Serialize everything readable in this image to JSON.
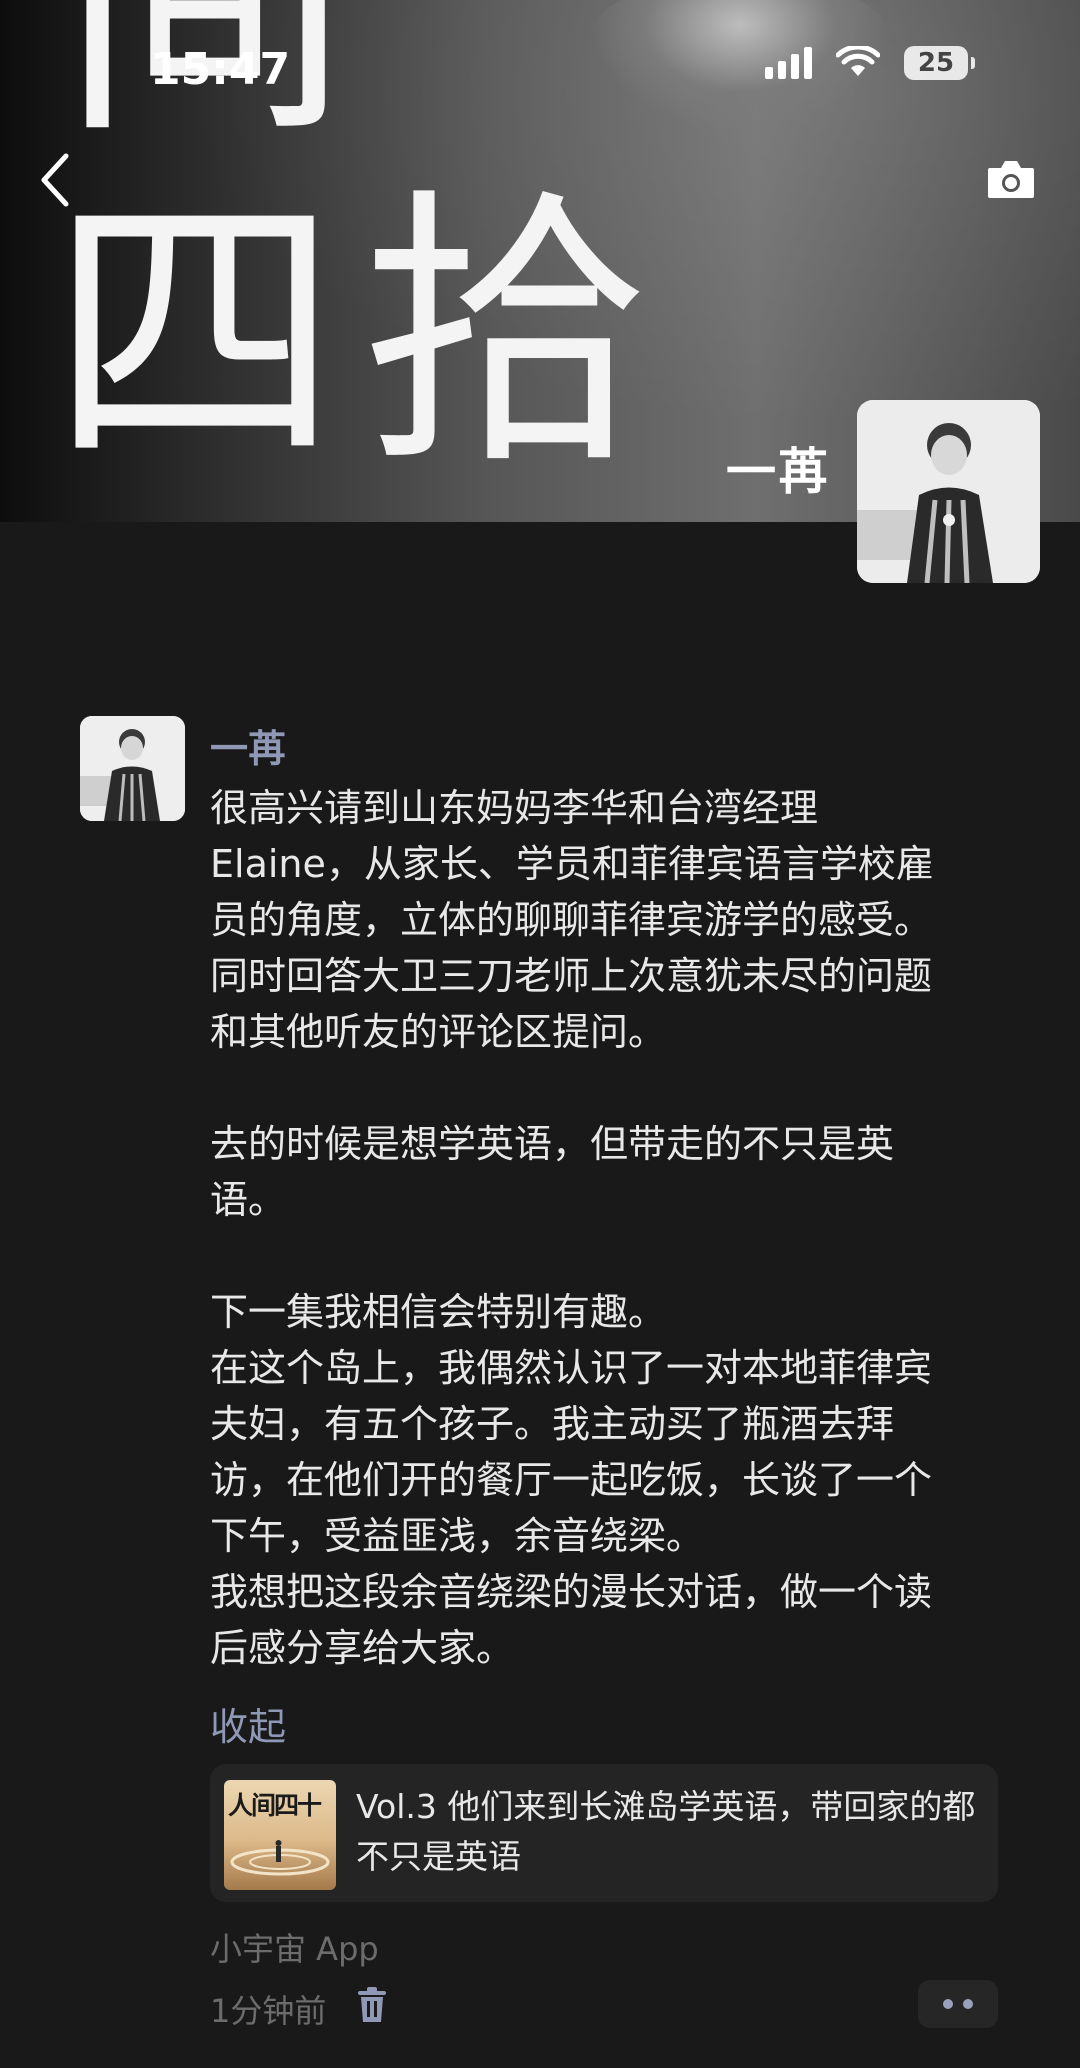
{
  "status_bar": {
    "time": "15:47",
    "battery": "25"
  },
  "cover": {
    "title_line1": "间",
    "title_line2": "四拾",
    "author": "一苒"
  },
  "comment": {
    "author": "一苒",
    "body": "很高兴请到山东妈妈李华和台湾经理\nElaine，从家长、学员和菲律宾语言学校雇\n员的角度，立体的聊聊菲律宾游学的感受。\n同时回答大卫三刀老师上次意犹未尽的问题\n和其他听友的评论区提问。\n\n去的时候是想学英语，但带走的不只是英\n语。\n\n下一集我相信会特别有趣。\n在这个岛上，我偶然认识了一对本地菲律宾\n夫妇，有五个孩子。我主动买了瓶酒去拜\n访，在他们开的餐厅一起吃饭，长谈了一个\n下午，受益匪浅，余音绕梁。\n我想把这段余音绕梁的漫长对话，做一个读\n后感分享给大家。",
    "collapse_label": "收起",
    "episode": {
      "thumb_text": "人间四十",
      "title": "Vol.3 他们来到长滩岛学英语，带回家的都不只是英语"
    },
    "source": "小宇宙 App",
    "time_ago": "1分钟前"
  },
  "icons": {
    "back": "chevron-left-icon",
    "camera": "camera-icon",
    "delete": "trash-icon",
    "more": "more-dots-icon"
  },
  "colors": {
    "background": "#191919",
    "accent_name": "#8f99b6",
    "card": "#242424"
  }
}
